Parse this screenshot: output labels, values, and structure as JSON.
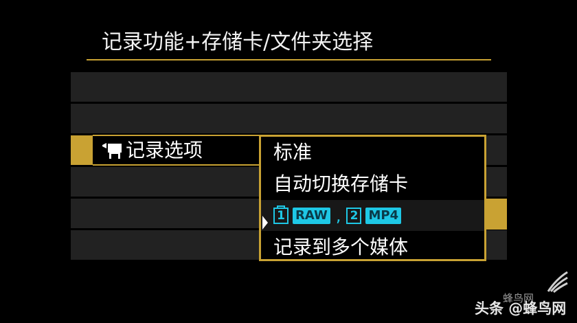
{
  "screen": {
    "title": "记录功能+存储卡/文件夹选择"
  },
  "option": {
    "icon": "movie-camera-icon",
    "label": "记录选项"
  },
  "dropdown": {
    "items": [
      {
        "label": "标准"
      },
      {
        "label": "自动切换存储卡"
      },
      {
        "label": "",
        "selected": true,
        "media": [
          {
            "slot": "1",
            "format": "RAW"
          },
          {
            "slot": "2",
            "format": "MP4"
          }
        ],
        "separator": ","
      },
      {
        "label": "记录到多个媒体"
      }
    ]
  },
  "colors": {
    "accent": "#c9a233",
    "media_cyan": "#1ec8e6",
    "background": "#000000",
    "row_bg": "#222222"
  },
  "watermark": {
    "site": "蜂鸟网",
    "credit": "头条 @蜂鸟网"
  }
}
